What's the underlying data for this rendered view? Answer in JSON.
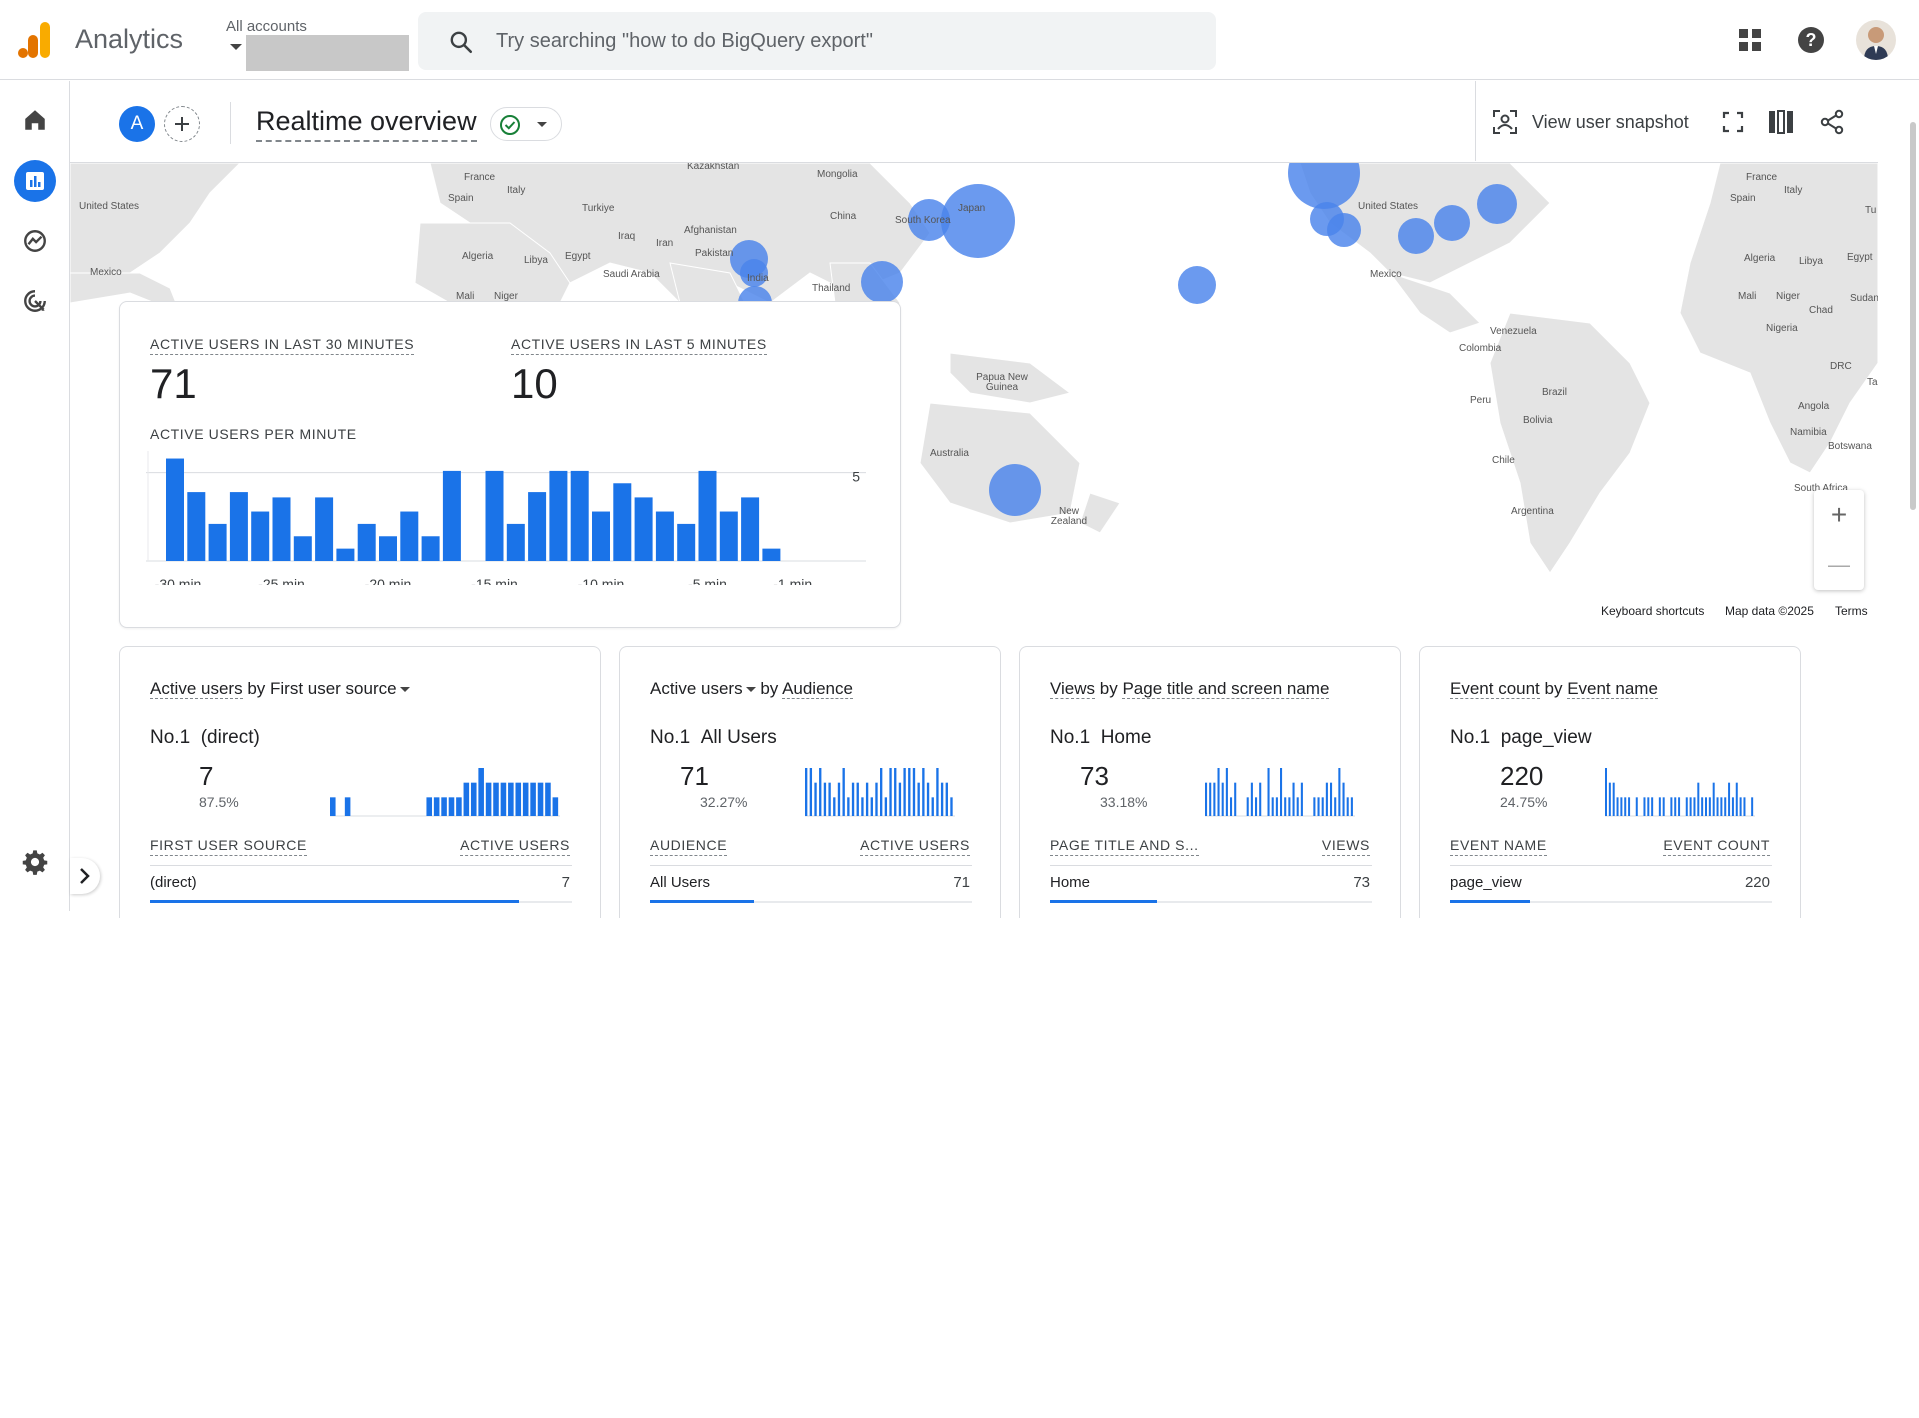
{
  "app": {
    "brand": "Analytics",
    "account_label": "All accounts",
    "search_placeholder": "Try searching \"how to do BigQuery export\""
  },
  "nav": {
    "items": [
      "home",
      "reports",
      "explore",
      "advertising",
      "settings"
    ]
  },
  "header": {
    "avatar_letter": "A",
    "title": "Realtime overview",
    "snapshot_label": "View user snapshot"
  },
  "map": {
    "labels": [
      {
        "t": "Kazakhstan"
      },
      {
        "t": "Mongolia"
      },
      {
        "t": "France"
      },
      {
        "t": "Italy"
      },
      {
        "t": "Spain"
      },
      {
        "t": "United States"
      },
      {
        "t": "Turkiye"
      },
      {
        "t": "China"
      },
      {
        "t": "South Korea"
      },
      {
        "t": "Japan"
      },
      {
        "t": "Afghanistan"
      },
      {
        "t": "Iraq"
      },
      {
        "t": "Iran"
      },
      {
        "t": "Pakistan"
      },
      {
        "t": "Algeria"
      },
      {
        "t": "Libya"
      },
      {
        "t": "Egypt"
      },
      {
        "t": "Saudi Arabia"
      },
      {
        "t": "Mexico"
      },
      {
        "t": "India"
      },
      {
        "t": "Thailand"
      },
      {
        "t": "Mali"
      },
      {
        "t": "Niger"
      },
      {
        "t": "Papua New Guinea"
      },
      {
        "t": "Australia"
      },
      {
        "t": "New Zealand"
      },
      {
        "t": "United States"
      },
      {
        "t": "Mexico"
      },
      {
        "t": "Venezuela"
      },
      {
        "t": "Colombia"
      },
      {
        "t": "Peru"
      },
      {
        "t": "Brazil"
      },
      {
        "t": "Bolivia"
      },
      {
        "t": "Chile"
      },
      {
        "t": "Argentina"
      },
      {
        "t": "France"
      },
      {
        "t": "Italy"
      },
      {
        "t": "Spain"
      },
      {
        "t": "Algeria"
      },
      {
        "t": "Libya"
      },
      {
        "t": "Egypt"
      },
      {
        "t": "Mali"
      },
      {
        "t": "Niger"
      },
      {
        "t": "Chad"
      },
      {
        "t": "Sudan"
      },
      {
        "t": "Nigeria"
      },
      {
        "t": "DRC"
      },
      {
        "t": "Angola"
      },
      {
        "t": "Namibia"
      },
      {
        "t": "Botswana"
      },
      {
        "t": "South Africa"
      },
      {
        "t": "Tu"
      },
      {
        "t": "Ta"
      }
    ],
    "footer": {
      "shortcuts": "Keyboard shortcuts",
      "data": "Map data ©2025",
      "terms": "Terms"
    },
    "zoom_in": "+",
    "zoom_out": "—"
  },
  "realtime": {
    "kpi1_label": "ACTIVE USERS IN LAST 30 MINUTES",
    "kpi1_value": "71",
    "kpi2_label": "ACTIVE USERS IN LAST 5 MINUTES",
    "kpi2_value": "10",
    "per_minute_label": "ACTIVE USERS PER MINUTE",
    "y_tick": "5",
    "x_ticks": [
      "-30 min",
      "-25 min",
      "-20 min",
      "-15 min",
      "-10 min",
      "-5 min",
      "-1 min"
    ]
  },
  "chart_data": {
    "type": "bar",
    "title": "ACTIVE USERS PER MINUTE",
    "categories": [
      "-30",
      "-29",
      "-28",
      "-27",
      "-26",
      "-25",
      "-24",
      "-23",
      "-22",
      "-21",
      "-20",
      "-19",
      "-18",
      "-17",
      "-16",
      "-15",
      "-14",
      "-13",
      "-12",
      "-11",
      "-10",
      "-9",
      "-8",
      "-7",
      "-6",
      "-5",
      "-4",
      "-3",
      "-2",
      "-1"
    ],
    "values": [
      5.8,
      3.9,
      2.1,
      3.9,
      2.8,
      3.6,
      1.4,
      3.6,
      0.7,
      2.1,
      1.4,
      2.8,
      1.4,
      5.1,
      0,
      5.1,
      2.1,
      3.9,
      5.1,
      5.1,
      2.8,
      4.4,
      3.6,
      2.8,
      2.1,
      5.1,
      2.8,
      3.6,
      0.7,
      0
    ],
    "ylim": [
      0,
      6
    ],
    "y_ticks": [
      5
    ]
  },
  "cards": [
    {
      "title_a": "Active users",
      "title_b": " by ",
      "title_c": "First user source",
      "rank": "No.1",
      "rank_name": "(direct)",
      "value": "7",
      "pct": "87.5%",
      "col_left": "FIRST USER SOURCE",
      "col_right": "ACTIVE USERS",
      "row_label": "(direct)",
      "row_value": "7",
      "share": 0.875,
      "spark": [
        1,
        0,
        1,
        0,
        0,
        0,
        0,
        0,
        0,
        0,
        0,
        0,
        0,
        1,
        1,
        1,
        1,
        1,
        2,
        2,
        3,
        2,
        2,
        2,
        2,
        2,
        2,
        2,
        2,
        2,
        1
      ]
    },
    {
      "title_a": "Active users",
      "title_b": " by ",
      "title_c": "Audience",
      "rank": "No.1",
      "rank_name": "All Users",
      "value": "71",
      "pct": "32.27%",
      "col_left": "AUDIENCE",
      "col_right": "ACTIVE USERS",
      "row_label": "All Users",
      "row_value": "71",
      "share": 0.3227,
      "spark": [
        3,
        3,
        2,
        3,
        2,
        2,
        1,
        2,
        3,
        1,
        2,
        2,
        1,
        2,
        1,
        2,
        3,
        1,
        3,
        3,
        2,
        3,
        3,
        3,
        2,
        3,
        2,
        1,
        3,
        2,
        2,
        1
      ]
    },
    {
      "title_a": "Views",
      "title_b": " by ",
      "title_c": "Page title and screen name",
      "rank": "No.1",
      "rank_name": "Home",
      "value": "73",
      "pct": "33.18%",
      "col_left": "PAGE TITLE AND S...",
      "col_right": "VIEWS",
      "row_label": "Home",
      "row_value": "73",
      "share": 0.3318,
      "spark": [
        2,
        2,
        2,
        3,
        2,
        3,
        1,
        2,
        0,
        0,
        1,
        2,
        1,
        2,
        0,
        3,
        1,
        1,
        3,
        1,
        1,
        2,
        1,
        2,
        0,
        0,
        1,
        1,
        1,
        2,
        2,
        1,
        3,
        2,
        1,
        1
      ]
    },
    {
      "title_a": "Event count",
      "title_b": " by ",
      "title_c": "Event name",
      "rank": "No.1",
      "rank_name": "page_view",
      "value": "220",
      "pct": "24.75%",
      "col_left": "EVENT NAME",
      "col_right": "EVENT COUNT",
      "row_label": "page_view",
      "row_value": "220",
      "share": 0.2475,
      "spark": [
        3,
        2,
        2,
        1,
        1,
        1,
        1,
        0,
        1,
        0,
        1,
        1,
        1,
        0,
        1,
        1,
        0,
        1,
        1,
        1,
        0,
        1,
        1,
        1,
        2,
        1,
        1,
        1,
        2,
        1,
        1,
        1,
        2,
        1,
        2,
        1,
        1,
        0,
        1
      ]
    }
  ],
  "colors": {
    "accent": "#1a73e8",
    "map_bubble": "#5c8ff0",
    "map_land": "#e4e4e4"
  }
}
